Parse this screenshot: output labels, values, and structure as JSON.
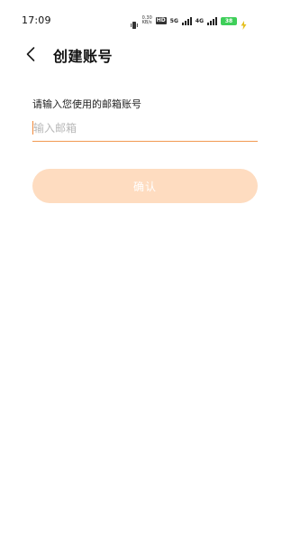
{
  "status_bar": {
    "time": "17:09",
    "net_speed_value": "0.30",
    "net_speed_unit": "KB/s",
    "hd_badge": "HD",
    "net_type_1": "5G",
    "net_type_2": "4G",
    "battery_level": "38",
    "icons": [
      "vibrate-icon",
      "signal-icon",
      "battery-icon",
      "charging-icon"
    ]
  },
  "header": {
    "title": "创建账号",
    "back_icon": "chevron-left-icon"
  },
  "form": {
    "label": "请输入您使用的邮箱账号",
    "email_value": "",
    "email_placeholder": "输入邮箱",
    "confirm_label": "确认"
  },
  "colors": {
    "accent": "#f0893b",
    "button_disabled": "#fedcc0",
    "battery": "#3fcf5a"
  }
}
